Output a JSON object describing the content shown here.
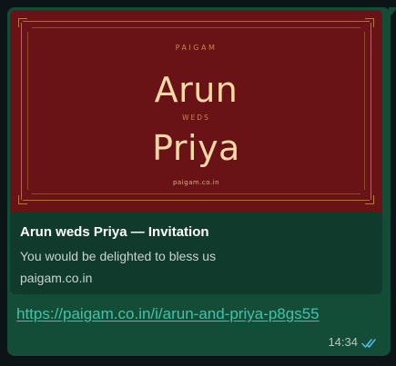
{
  "message": {
    "invite_image": {
      "brand": "PAIGAM",
      "name_first": "Arun",
      "connector": "WEDS",
      "name_second": "Priya",
      "footer": "paigam.co.in",
      "colors": {
        "background": "#6a1317",
        "ornament": "#a8723a",
        "names": "#f4d9a6"
      }
    },
    "preview": {
      "title": "Arun weds Priya — Invitation",
      "description": "You would be delighted to bless us",
      "domain": "paigam.co.in"
    },
    "link_text": "https://paigam.co.in/i/arun-and-priya-p8gs55",
    "time": "14:34",
    "status_icon": "double-check-read-icon",
    "colors": {
      "bubble": "#144d37",
      "link": "#3fc4a8",
      "read_ticks": "#53bdeb"
    }
  }
}
